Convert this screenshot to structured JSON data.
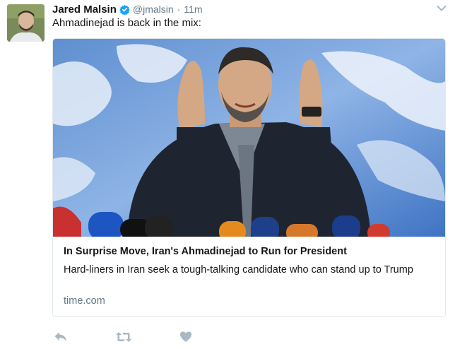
{
  "tweet": {
    "author": {
      "full_name": "Jared Malsin",
      "handle": "@jmalsin",
      "verified": true,
      "avatar_icon": "profile-photo"
    },
    "separator": "·",
    "timestamp": "11m",
    "text": "Ahmadinejad is back in the mix:",
    "menu_icon": "chevron-down-icon"
  },
  "card": {
    "image_icon": "news-photo",
    "title": "In Surprise Move, Iran's Ahmadinejad to Run for President",
    "description": "Hard-liners in Iran seek a tough-talking candidate who can stand up to Trump",
    "domain": "time.com"
  },
  "actions": {
    "reply_icon": "reply-icon",
    "retweet_icon": "retweet-icon",
    "like_icon": "heart-icon"
  },
  "colors": {
    "text": "#14171a",
    "secondary": "#657786",
    "verified_blue": "#1da1f2",
    "border": "#e1e8ed",
    "action_gray": "#aab8c2"
  }
}
